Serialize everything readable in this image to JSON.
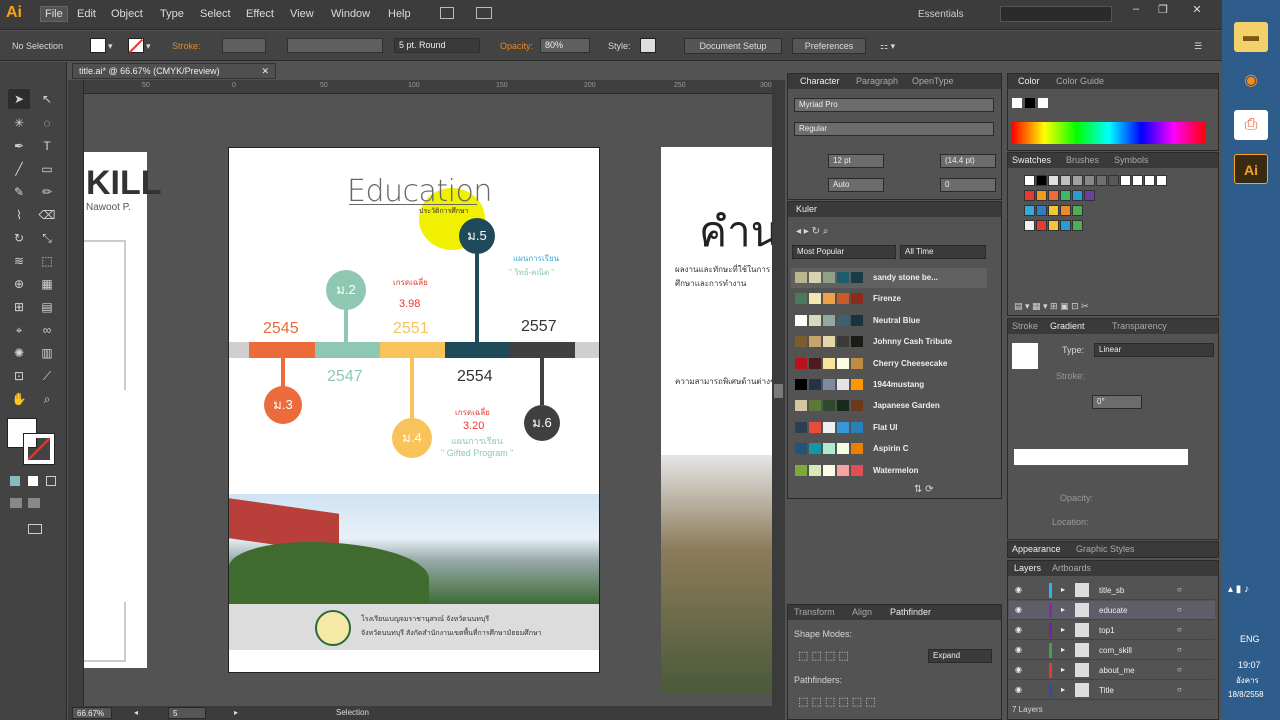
{
  "app": {
    "logo": "Ai"
  },
  "menu": [
    {
      "label": "File",
      "active": true
    },
    {
      "label": "Edit"
    },
    {
      "label": "Object"
    },
    {
      "label": "Type"
    },
    {
      "label": "Select"
    },
    {
      "label": "Effect"
    },
    {
      "label": "View"
    },
    {
      "label": "Window"
    },
    {
      "label": "Help"
    }
  ],
  "workspace": "Essentials",
  "control": {
    "selection": "No Selection",
    "stroke_label": "Stroke:",
    "brush": "5 pt. Round",
    "opacity_label": "Opacity:",
    "opacity": "80%",
    "style_label": "Style:",
    "document_setup": "Document Setup",
    "preferences": "Preferences"
  },
  "document": {
    "tab": "title.ai* @ 66.67% (CMYK/Preview)",
    "zoom": "66.67%",
    "page": "5",
    "status_tool": "Selection",
    "rulers": [
      "50",
      "0",
      "50",
      "100",
      "150",
      "200",
      "250",
      "300"
    ]
  },
  "artboard": {
    "title": "Education",
    "subtitle": "ประวัติการศึกษา",
    "milestones": [
      {
        "label": "ม.2",
        "color": "#8fc8b2"
      },
      {
        "label": "ม.3",
        "color": "#ec6b3b"
      },
      {
        "label": "ม.4",
        "color": "#f8c35b"
      },
      {
        "label": "ม.5",
        "color": "#1f4a5a"
      },
      {
        "label": "ม.6",
        "color": "#404040"
      }
    ],
    "years": [
      "2545",
      "2547",
      "2551",
      "2554",
      "2557"
    ],
    "grade1_label": "เกรดเฉลี่ย",
    "grade1": "3.98",
    "grade2_label": "เกรดเฉลี่ย",
    "grade2": "3.20",
    "program1_label": "แผนการเรียน",
    "program1": "\" วิทย์-คณิต \"",
    "program2_label": "แผนการเรียน",
    "program2": "\" Gifted Program \"",
    "school_line1": "โรงเรียนเบญจมราชานุสรณ์ จังหวัดนนทบุรี",
    "school_line2": "จังหวัดนนทบุรี สังกัดสำนักงานเขตพื้นที่การศึกษามัธยมศึกษา"
  },
  "side_art": {
    "left_text": "KILL",
    "left_sub": "Nawoot P.",
    "right_heading": "คำน",
    "right_body": "ผลงานและทักษะที่ใช้ในการศึกษาและการทำงาน",
    "right_body2": "ความสามารถพิเศษด้านต่างๆ"
  },
  "character": {
    "tabs": [
      "Character",
      "Paragraph",
      "OpenType"
    ],
    "font": "Myriad Pro",
    "style": "Regular",
    "size": "12 pt",
    "leading": "(14.4 pt)",
    "kerning": "Auto",
    "tracking": "0"
  },
  "kuler": {
    "title": "Kuler",
    "filter1": "Most Popular",
    "filter2": "All Time",
    "themes": [
      {
        "name": "sandy stone be...",
        "colors": [
          "#b9b58f",
          "#d8d3b0",
          "#8ea28a",
          "#1d5c6a",
          "#1a3a44"
        ]
      },
      {
        "name": "Firenze",
        "colors": [
          "#4b7a5b",
          "#f3e6b3",
          "#f0a04b",
          "#c85a2a",
          "#8e2c1c"
        ]
      },
      {
        "name": "Neutral Blue",
        "colors": [
          "#fcfff5",
          "#d1dbbd",
          "#91aa9d",
          "#3e606f",
          "#193441"
        ]
      },
      {
        "name": "Johnny Cash Tribute",
        "colors": [
          "#7b5d2e",
          "#c7a56a",
          "#e7d7a8",
          "#3b3a35",
          "#1b1a17"
        ]
      },
      {
        "name": "Cherry Cheesecake",
        "colors": [
          "#b9121b",
          "#4c1b1b",
          "#f6e497",
          "#fcfae1",
          "#bd8d46"
        ]
      },
      {
        "name": "1944mustang",
        "colors": [
          "#000000",
          "#263248",
          "#7e8aa2",
          "#e3e3e3",
          "#ff9800"
        ]
      },
      {
        "name": "Japanese Garden",
        "colors": [
          "#d4c6a0",
          "#5b7a3a",
          "#2e4a2a",
          "#1a2a1a",
          "#6b3a1a"
        ]
      },
      {
        "name": "Flat UI",
        "colors": [
          "#2c3e50",
          "#e74c3c",
          "#ecf0f1",
          "#3498db",
          "#2980b9"
        ]
      },
      {
        "name": "Aspirin C",
        "colors": [
          "#225378",
          "#1695a3",
          "#aceccf",
          "#f3ffe2",
          "#eb7f00"
        ]
      },
      {
        "name": "Watermelon",
        "colors": [
          "#7fa83a",
          "#d9e8b8",
          "#fdfbe8",
          "#f9a3a0",
          "#e24e56"
        ]
      }
    ]
  },
  "color_panel": {
    "tabs": [
      "Color",
      "Color Guide"
    ]
  },
  "swatches": {
    "tabs": [
      "Swatches",
      "Brushes",
      "Symbols"
    ],
    "grid": [
      [
        "#ffffff",
        "#000000",
        "#e0e0e0",
        "#c0c0c0",
        "#a0a0a0",
        "#888888",
        "#707070",
        "#585858",
        "#ffffff",
        "#ffffff",
        "#ffffff",
        "#ffffff"
      ],
      [
        "#e83a2e",
        "#f39a1f",
        "#ec6b3b",
        "#3fb66a",
        "#2b9bd4",
        "#6b3fa0"
      ],
      [
        "#3aa8d8",
        "#2f7ec0",
        "#f5c53a",
        "#ef8a2a",
        "#4caf50"
      ],
      [
        "#f0f0f0",
        "#e83a2e",
        "#f5c53a",
        "#2b9bd4",
        "#4caf50"
      ]
    ]
  },
  "gradient": {
    "tabs": [
      "Stroke",
      "Gradient",
      "Transparency"
    ],
    "type_label": "Type:",
    "type": "Linear",
    "stroke_label": "Stroke:",
    "angle": "0°",
    "opacity_label": "Opacity:",
    "location_label": "Location:"
  },
  "transform": {
    "tabs": [
      "Transform",
      "Align",
      "Pathfinder"
    ],
    "shape_modes": "Shape Modes:",
    "expand": "Expand",
    "pathfinders": "Pathfinders:"
  },
  "appearance": {
    "tabs": [
      "Appearance",
      "Graphic Styles"
    ]
  },
  "layers": {
    "tabs": [
      "Layers",
      "Artboards"
    ],
    "items": [
      {
        "name": "title_sb",
        "color": "#29b6f6"
      },
      {
        "name": "educate",
        "color": "#8e24aa",
        "selected": true
      },
      {
        "name": "top1",
        "color": "#7b1fa2"
      },
      {
        "name": "com_skill",
        "color": "#43a047"
      },
      {
        "name": "about_me",
        "color": "#e53935"
      },
      {
        "name": "Title",
        "color": "#3949ab"
      }
    ],
    "count": "7 Layers"
  },
  "taskbar": {
    "lang": "ENG",
    "time": "19:07",
    "day": "อังคาร",
    "date": "18/8/2558"
  }
}
